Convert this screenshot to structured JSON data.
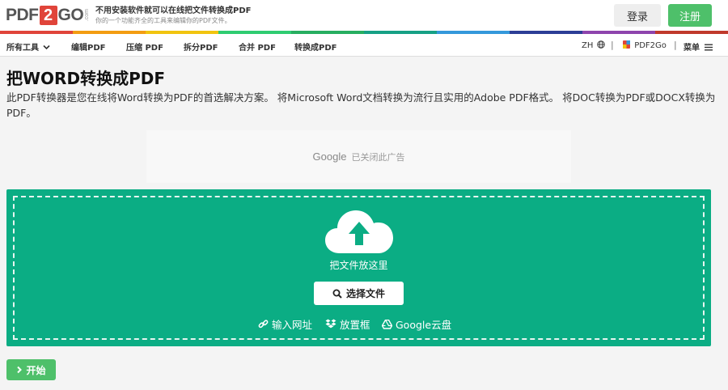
{
  "header": {
    "logo": {
      "left": "PDF",
      "box": "2",
      "right": "GO",
      "suffix": ".com"
    },
    "tagline_main": "不用安装软件就可以在线把文件转换成PDF",
    "tagline_sub": "你的一个功能齐全的工具来编辑你的PDF文件。",
    "login_label": "登录",
    "signup_label": "注册"
  },
  "rainbow_colors": [
    "#e0443a",
    "#f39c12",
    "#f1c40f",
    "#2ecc71",
    "#27ae60",
    "#16a085",
    "#3498db",
    "#2c3e96",
    "#8e44ad",
    "#c0392b"
  ],
  "nav": {
    "items": [
      "所有工具",
      "编辑PDF",
      "压缩 PDF",
      "拆分PDF",
      "合并 PDF",
      "转换成PDF"
    ],
    "language": "ZH",
    "separator": "|",
    "brand": "PDF2Go",
    "menu": "菜单"
  },
  "main": {
    "title": "把WORD转换成PDF",
    "description": "此PDF转换器是您在线将Word转换为PDF的首选解决方案。 将Microsoft Word文档转换为流行且实用的Adobe PDF格式。 将DOC转换为PDF或DOCX转换为PDF。",
    "ad_brand": "Google",
    "ad_text": "已关闭此广告",
    "drop_label": "把文件放这里",
    "choose_label": "选择文件",
    "sources": [
      "输入网址",
      "放置框",
      "Google云盘"
    ],
    "start_label": "开始"
  },
  "colors": {
    "accent": "#0bad84",
    "green_button": "#4ec06a",
    "brand_red": "#e0443a"
  }
}
